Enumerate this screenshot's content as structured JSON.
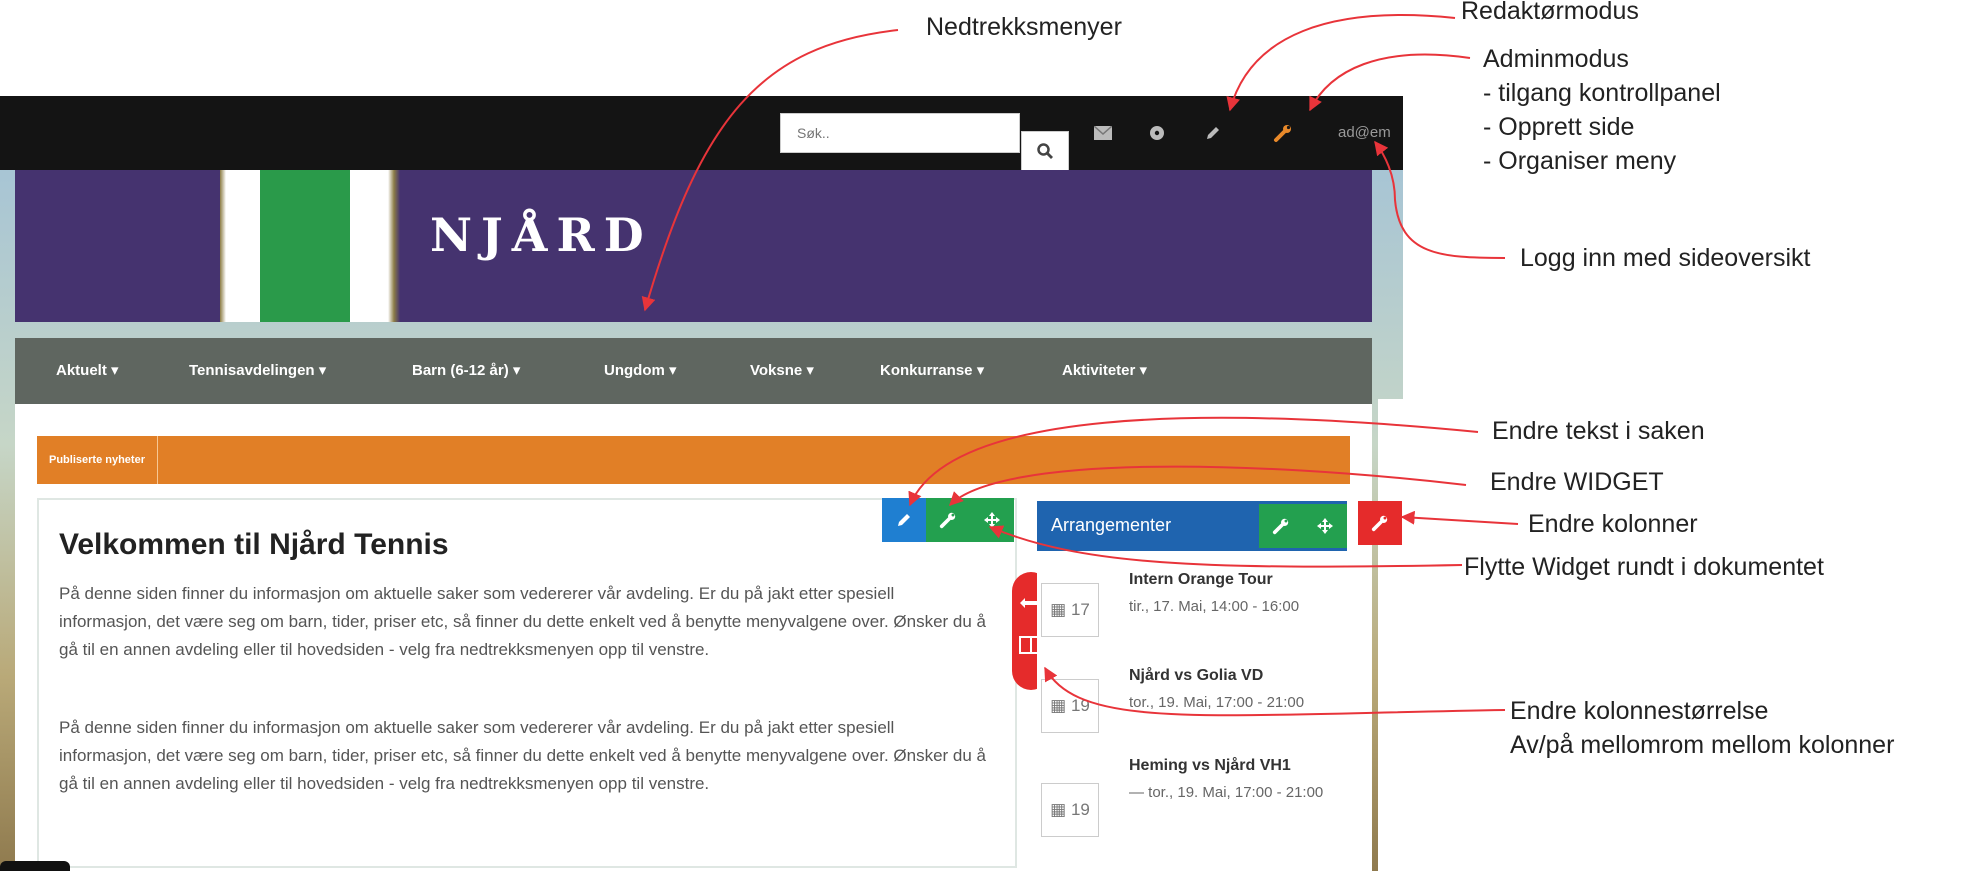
{
  "screenshot": {
    "search": {
      "placeholder": "Søk.."
    },
    "user_label": "ad@em",
    "logo": "NJÅRD",
    "nav_items": [
      {
        "label": "Aktuelt"
      },
      {
        "label": "Tennisavdelingen"
      },
      {
        "label": "Barn (6-12 år)"
      },
      {
        "label": "Ungdom"
      },
      {
        "label": "Voksne"
      },
      {
        "label": "Konkurranse"
      },
      {
        "label": "Aktiviteter"
      }
    ],
    "orange_tab": "Publiserte nyheter",
    "main": {
      "title": "Velkommen til Njård Tennis",
      "paragraphs": [
        "På denne siden finner du informasjon om aktuelle saker som vedererer vår avdeling. Er du på jakt etter spesiell informasjon, det være seg om barn, tider, priser etc, så finner du dette enkelt ved å benytte menyvalgene over. Ønsker du å gå til en annen avdeling eller til hovedsiden - velg fra nedtrekksmenyen opp til venstre.",
        "På denne siden finner du informasjon om aktuelle saker som vedererer vår avdeling. Er du på jakt etter spesiell informasjon, det være seg om barn, tider, priser etc, så finner du dette enkelt ved å benytte menyvalgene over. Ønsker du å gå til en annen avdeling eller til hovedsiden - velg fra nedtrekksmenyen opp til venstre."
      ]
    },
    "events": {
      "title": "Arrangementer",
      "items": [
        {
          "day": "17",
          "title": "Intern Orange Tour",
          "time": "tir., 17. Mai, 14:00 - 16:00"
        },
        {
          "day": "19",
          "title": "Njård vs Golia VD",
          "time": "tor., 19. Mai, 17:00 - 21:00"
        },
        {
          "day": "19",
          "title": "Heming vs Njård VH1",
          "time": "— tor., 19. Mai, 17:00 - 21:00"
        }
      ]
    }
  },
  "annotations": {
    "nedtrekksmenyer": "Nedtrekksmenyer",
    "redaktor": "Redaktørmodus",
    "admin_lines": [
      "Adminmodus",
      " - tilgang kontrollpanel",
      " - Opprett side",
      " - Organiser meny"
    ],
    "logg_inn": "Logg inn med sideoversikt",
    "endre_tekst": "Endre tekst i saken",
    "endre_widget": "Endre WIDGET",
    "endre_kolonner": "Endre kolonner",
    "flytte_widget": "Flytte Widget rundt i dokumentet",
    "kolonnestorrelse_lines": [
      "Endre kolonnestørrelse",
      "Av/på mellomrom mellom kolonner"
    ]
  },
  "colors": {
    "annotation_arrow": "#e8343a",
    "banner": "#45336f",
    "nav": "#5f6660",
    "orange": "#e17f26",
    "edit_blue": "#1f7fd1",
    "widget_green": "#23a04f",
    "column_red": "#e52b2b",
    "events_header": "#1f64af"
  },
  "icons": [
    "search-icon",
    "mail-icon",
    "globe-icon",
    "pencil-icon",
    "wrench-icon",
    "move-icon",
    "calendar-icon",
    "resize-horizontal-icon",
    "columns-icon"
  ]
}
